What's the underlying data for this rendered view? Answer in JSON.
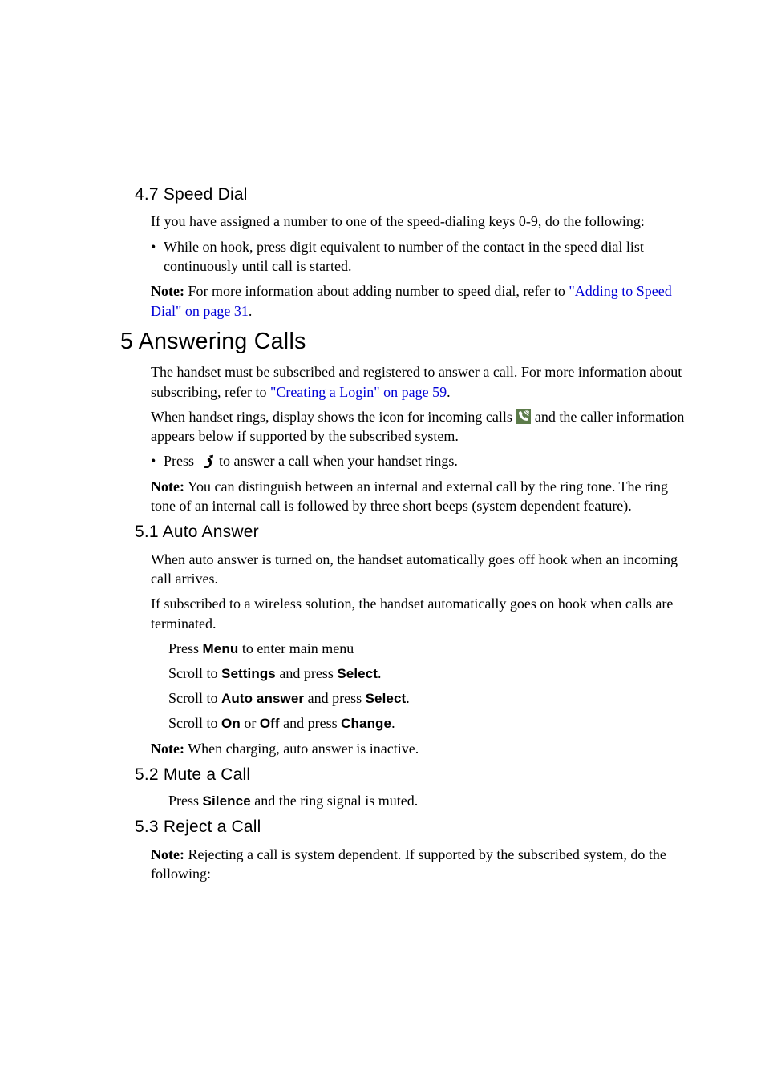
{
  "s47": {
    "heading": "4.7  Speed Dial",
    "p1": "If you have assigned a number to one of the speed-dialing keys 0-9, do the following:",
    "bullet1": "While on hook, press digit equivalent to number of the contact in the speed dial list continuously until call is started.",
    "note_lead": "Note:",
    "note_text": " For more information about adding number to speed dial, refer to ",
    "note_link": "\"Adding to Speed Dial\" on page 31",
    "note_tail": "."
  },
  "s5": {
    "heading": "5 Answering Calls",
    "p1a": "The handset must be subscribed and registered to answer a call. For more information about subscribing, refer to ",
    "p1_link": "\"Creating a Login\" on page 59",
    "p1b": ".",
    "p2a": "When handset rings, display shows the icon for incoming calls ",
    "p2b": " and the caller infor­mation appears below if supported by the subscribed system.",
    "bullet1a": "Press  ",
    "bullet1b": "  to answer a call when your handset rings.",
    "note_lead": "Note:",
    "note_text": " You can distinguish between an internal and external call by the ring tone. The ring tone of an internal call is followed by three short beeps (system dependent feature)."
  },
  "s51": {
    "heading": "5.1  Auto Answer",
    "p1": "When auto answer is turned on, the handset automatically goes off hook when an incoming call arrives.",
    "p2": "If subscribed to a wireless solution, the handset automatically goes on hook when calls are terminated.",
    "step1a": "Press ",
    "step1_label": "Menu",
    "step1b": " to enter main menu",
    "step2a": "Scroll to ",
    "step2_label1": "Settings",
    "step2b": " and press ",
    "step2_label2": "Select",
    "step2c": ".",
    "step3a": "Scroll to ",
    "step3_label1": "Auto answer",
    "step3b": " and press ",
    "step3_label2": "Select",
    "step3c": ".",
    "step4a": "Scroll to ",
    "step4_label1": "On",
    "step4b": " or ",
    "step4_label2": "Off",
    "step4c": " and press ",
    "step4_label3": "Change",
    "step4d": ".",
    "note_lead": "Note:",
    "note_text": " When charging, auto answer is inactive."
  },
  "s52": {
    "heading": "5.2  Mute a Call",
    "step1a": " Press ",
    "step1_label": "Silence",
    "step1b": " and the ring signal is muted."
  },
  "s53": {
    "heading": "5.3  Reject a Call",
    "note_lead": "Note:",
    "note_text": " Rejecting a call is system dependent. If supported by the subscribed system, do the following:"
  }
}
